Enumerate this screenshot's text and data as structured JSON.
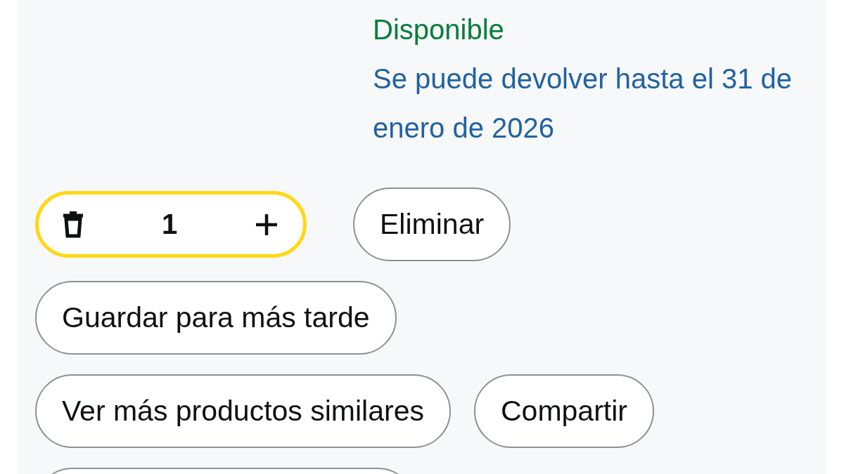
{
  "availability": "Disponible",
  "return_note": "Se puede devolver hasta el 31 de enero de 2026",
  "quantity": {
    "value": "1",
    "focused": true
  },
  "actions": [
    {
      "label": "Eliminar"
    },
    {
      "label": "Guardar para más tarde"
    },
    {
      "label": "Ver más productos similares"
    },
    {
      "label": "Compartir"
    }
  ]
}
